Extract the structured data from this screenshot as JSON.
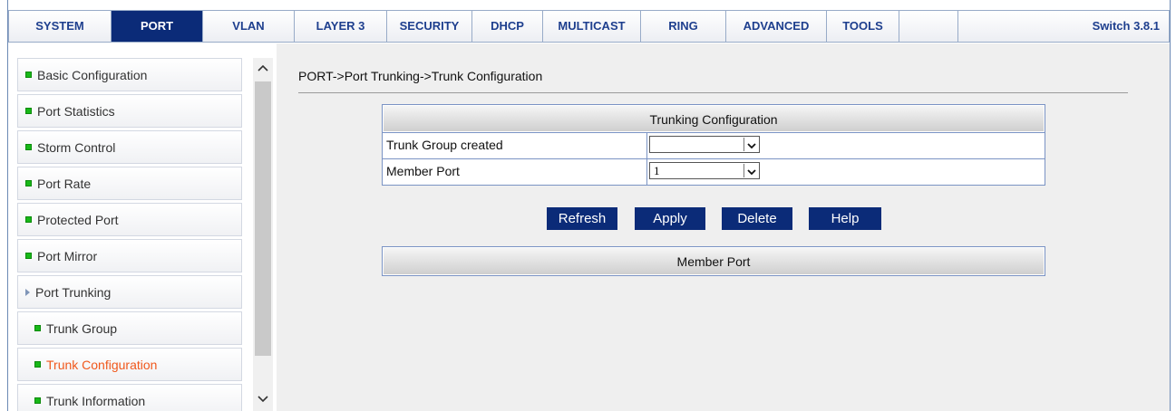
{
  "nav": {
    "tabs": [
      {
        "label": "SYSTEM",
        "active": false
      },
      {
        "label": "PORT",
        "active": true
      },
      {
        "label": "VLAN",
        "active": false
      },
      {
        "label": "LAYER 3",
        "active": false
      },
      {
        "label": "SECURITY",
        "active": false
      },
      {
        "label": "DHCP",
        "active": false
      },
      {
        "label": "MULTICAST",
        "active": false
      },
      {
        "label": "RING",
        "active": false
      },
      {
        "label": "ADVANCED",
        "active": false
      },
      {
        "label": "TOOLS",
        "active": false
      }
    ],
    "version": "Switch 3.8.1"
  },
  "sidebar": {
    "items": [
      {
        "label": "Basic Configuration"
      },
      {
        "label": "Port Statistics"
      },
      {
        "label": "Storm Control"
      },
      {
        "label": "Port Rate"
      },
      {
        "label": "Protected Port"
      },
      {
        "label": "Port Mirror"
      },
      {
        "label": "Port Trunking"
      },
      {
        "label": "Trunk Group"
      },
      {
        "label": "Trunk Configuration"
      },
      {
        "label": "Trunk Information"
      }
    ]
  },
  "main": {
    "breadcrumb": "PORT->Port Trunking->Trunk Configuration",
    "config": {
      "title": "Trunking Configuration",
      "trunk_group_label": "Trunk Group created",
      "trunk_group_value": "",
      "member_port_label": "Member Port",
      "member_port_value": "1"
    },
    "buttons": {
      "refresh": "Refresh",
      "apply": "Apply",
      "delete": "Delete",
      "help": "Help"
    },
    "member_table": {
      "header": "Member Port"
    }
  },
  "colors": {
    "nav_active_bg": "#0b2b78",
    "button_bg": "#0b2b78",
    "active_menu_text": "#f0581c",
    "bullet": "#18b818"
  }
}
